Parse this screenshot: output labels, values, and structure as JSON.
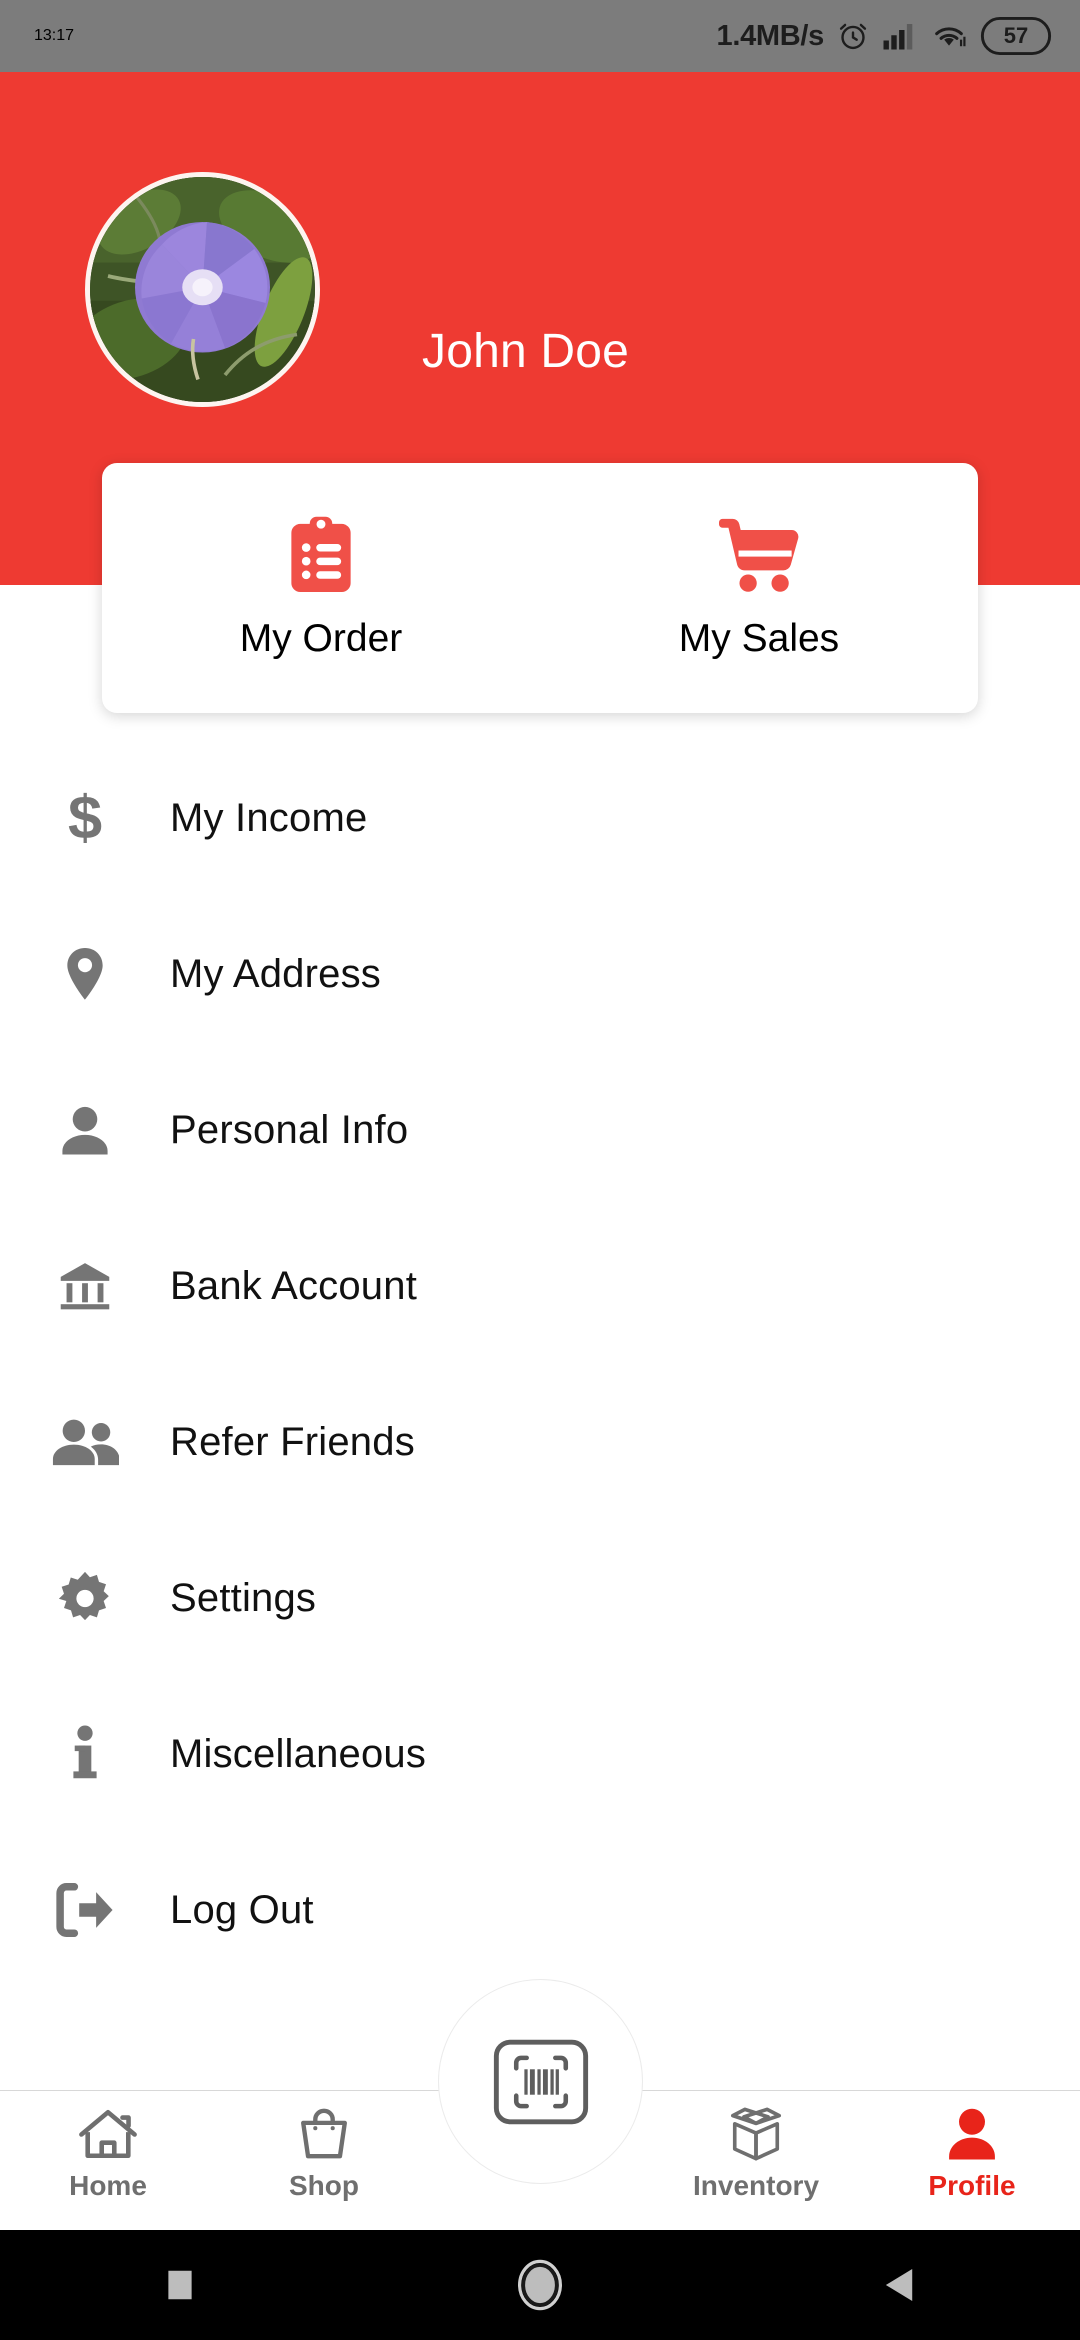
{
  "status_bar": {
    "clock": "13:17",
    "network_speed": "1.4MB/s",
    "battery_level": "57",
    "icons": [
      "alarm-clock-icon",
      "signal-bars-icon",
      "wifi-icon",
      "battery-icon"
    ],
    "background_color": "#7c7c7c"
  },
  "header": {
    "profile_name": "John Doe",
    "avatar_description": "purple-morning-glory-flower-photo",
    "background_color": "#ee3a32"
  },
  "quick_actions": {
    "items": [
      {
        "label": "My Order",
        "icon": "clipboard-list-icon"
      },
      {
        "label": "My Sales",
        "icon": "shopping-cart-icon"
      }
    ],
    "accent_color": "#f05048"
  },
  "menu": {
    "items": [
      {
        "label": "My Income",
        "icon": "dollar-sign-icon"
      },
      {
        "label": "My Address",
        "icon": "location-pin-icon"
      },
      {
        "label": "Personal Info",
        "icon": "person-icon"
      },
      {
        "label": "Bank Account",
        "icon": "bank-building-icon"
      },
      {
        "label": "Refer Friends",
        "icon": "people-group-icon"
      },
      {
        "label": "Settings",
        "icon": "gear-icon"
      },
      {
        "label": "Miscellaneous",
        "icon": "info-icon"
      },
      {
        "label": "Log Out",
        "icon": "logout-arrow-icon"
      }
    ],
    "icon_color": "#757575",
    "label_color": "#111111"
  },
  "bottom_nav": {
    "items": [
      {
        "label": "Home",
        "icon": "home-icon",
        "active": false
      },
      {
        "label": "Shop",
        "icon": "shopping-bag-icon",
        "active": false
      },
      {
        "label": "Inventory",
        "icon": "open-box-icon",
        "active": false
      },
      {
        "label": "Profile",
        "icon": "person-filled-icon",
        "active": true
      }
    ],
    "fab": {
      "icon": "barcode-scan-icon"
    },
    "active_color": "#e8241a",
    "inactive_color": "#6f6f6f"
  },
  "android_nav": {
    "buttons": [
      {
        "name": "recents",
        "icon": "square-icon"
      },
      {
        "name": "home",
        "icon": "circle-icon"
      },
      {
        "name": "back",
        "icon": "triangle-left-icon"
      }
    ]
  }
}
